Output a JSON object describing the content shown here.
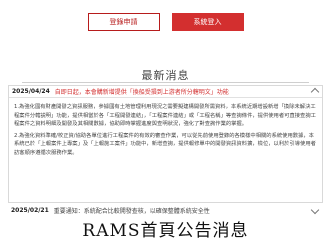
{
  "header": {
    "login_label": "登錄申請",
    "member_label": "系統登入"
  },
  "section_title": "最新消息",
  "announcements": [
    {
      "date": "2025/04/24",
      "title": "自即日起，本會購新增提供「換船受損到上游者所分轄明文」功能",
      "paragraphs": [
        "1.為強化國有財產開發之資訊服務，參據國有土地管理利用現況之需要擬建構開發所需資料，本系統近期增設新增「換除未解決工程案件分轄説明」功能，提供相當於各「工程開發連結」，「工程案件連結」或「工程名稱」等查詢條件，提供使用者可直接查詢工程案件之資料明細及開發及其相關數據，協助即時掌握進度與查明狀況，強化了對查詢作業的掌握。",
        "2.為強化資料準確/校正資/協助各單位進行工程案件的有效的審查作業，可以從先前使用登錄的各模樣中相關的系統使用數據，本系統已於「上報案件上專案」及「上報施工案件」功能中，新增查詢，提供報修單中的開發資訊資料擴，檢位，以利於引導使用者訪客順序遵循次服務作業。"
      ]
    },
    {
      "date": "2025/02/21",
      "title": "重要通知：系統配合比較開發查核，以確保整體系統安全性"
    }
  ],
  "caption": "RAMS首頁公告消息",
  "colors": {
    "accent": "#d32f2f",
    "accent_dark": "#b71c1c"
  }
}
